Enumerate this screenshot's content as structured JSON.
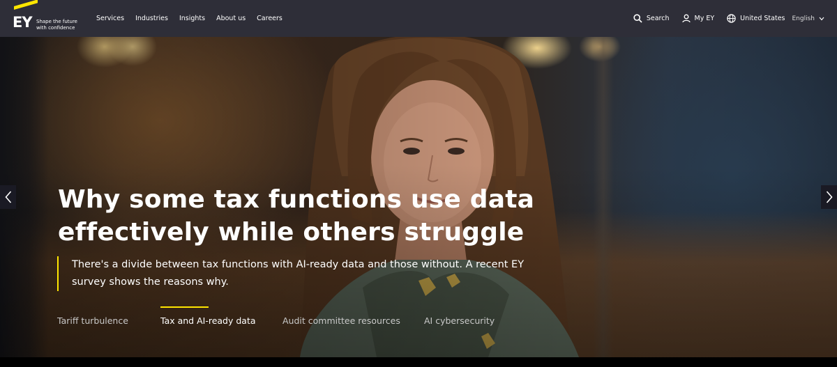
{
  "brand": {
    "logo_text": "EY",
    "tagline_line1": "Shape the future",
    "tagline_line2": "with confidence",
    "accent_color": "#ffe600"
  },
  "nav": {
    "items": [
      {
        "label": "Services"
      },
      {
        "label": "Industries"
      },
      {
        "label": "Insights"
      },
      {
        "label": "About us"
      },
      {
        "label": "Careers"
      }
    ]
  },
  "utility": {
    "search_label": "Search",
    "search_icon": "search-icon",
    "account_label": "My EY",
    "account_icon": "user-icon",
    "region_label": "United States",
    "language_label": "English",
    "region_icon": "globe-icon",
    "dropdown_icon": "chevron-down-icon"
  },
  "hero": {
    "headline_line1": "Why some tax functions use data",
    "headline_line2": "effectively while others struggle",
    "subtext_line1": "There's a divide between tax functions with AI-ready data and those without. A recent EY",
    "subtext_line2": "survey shows the reasons why.",
    "prev_icon": "chevron-left-icon",
    "next_icon": "chevron-right-icon"
  },
  "tabs": {
    "items": [
      {
        "label": "Tariff turbulence",
        "active": false
      },
      {
        "label": "Tax and AI-ready data",
        "active": true
      },
      {
        "label": "Audit committee resources",
        "active": false
      },
      {
        "label": "AI cybersecurity",
        "active": false
      }
    ]
  }
}
